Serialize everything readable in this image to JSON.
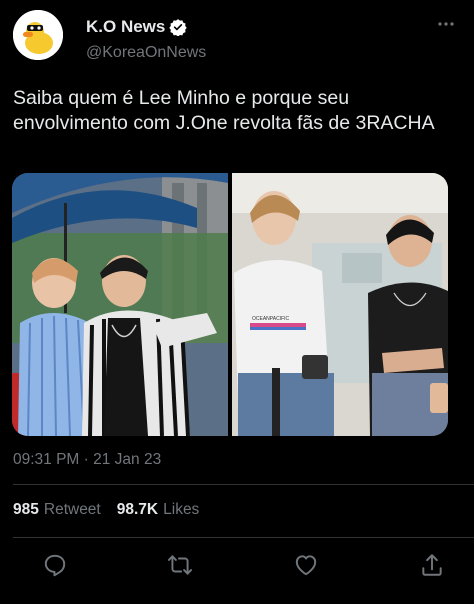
{
  "tweet": {
    "author_name": "K.O News",
    "author_handle": "@KoreaOnNews",
    "text": "Saiba quem é Lee Minho e porque seu envolvimento com J.One revolta fãs de 3RACHA",
    "timestamp": "09:31 PM · 21 Jan 23",
    "retweets_count": "985",
    "retweets_label": "Retweet",
    "likes_count": "98.7K",
    "likes_label": "Likes",
    "media_left_shirt_text": "OCEANPACIFIC"
  },
  "icons": {
    "avatar": "duck-avatar-icon",
    "verified": "verified-badge-icon",
    "more": "more-options-icon",
    "reply": "reply-icon",
    "retweet": "retweet-icon",
    "like": "heart-icon",
    "share": "share-icon"
  },
  "colors": {
    "background": "#000000",
    "text": "#e7e9ea",
    "secondary": "#71767b",
    "divider": "#2f3336",
    "verified": "#ffffff"
  }
}
